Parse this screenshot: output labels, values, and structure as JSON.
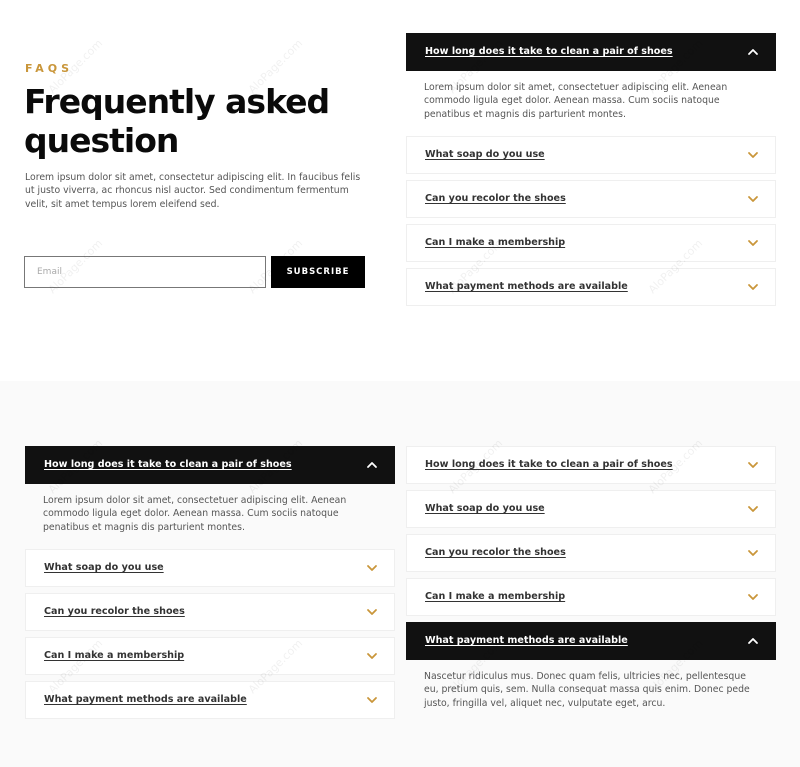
{
  "colors": {
    "accent": "#c9963a",
    "dark": "#111111",
    "body_text": "#555555",
    "section_alt_bg": "#fafafa"
  },
  "hero": {
    "eyebrow": "FAQS",
    "title": "Frequently asked question",
    "description": "Lorem ipsum dolor sit amet, consectetur adipiscing elit. In faucibus felis ut justo viverra, ac rhoncus nisl auctor. Sed condimentum fermentum velit, sit amet tempus lorem eleifend sed.",
    "email_placeholder": "Email",
    "email_value": "",
    "subscribe_label": "SUBSCRIBE"
  },
  "accordion_top_right": {
    "items": [
      {
        "title": "How long does it take to clean a pair of shoes",
        "open": true,
        "icon": "chevron-up-icon",
        "body": "Lorem ipsum dolor sit amet, consectetuer adipiscing elit. Aenean commodo ligula eget dolor. Aenean massa. Cum sociis natoque penatibus et magnis dis parturient montes."
      },
      {
        "title": "What soap do you use",
        "open": false,
        "icon": "chevron-down-icon"
      },
      {
        "title": "Can you recolor the shoes",
        "open": false,
        "icon": "chevron-down-icon"
      },
      {
        "title": "Can I make a membership",
        "open": false,
        "icon": "chevron-down-icon"
      },
      {
        "title": "What payment methods are available",
        "open": false,
        "icon": "chevron-down-icon"
      }
    ]
  },
  "accordion_bottom_left": {
    "items": [
      {
        "title": "How long does it take to clean a pair of shoes",
        "open": true,
        "icon": "chevron-up-icon",
        "body": "Lorem ipsum dolor sit amet, consectetuer adipiscing elit. Aenean commodo ligula eget dolor. Aenean massa. Cum sociis natoque penatibus et magnis dis parturient montes."
      },
      {
        "title": "What soap do you use",
        "open": false,
        "icon": "chevron-down-icon"
      },
      {
        "title": "Can you recolor the shoes",
        "open": false,
        "icon": "chevron-down-icon"
      },
      {
        "title": "Can I make a membership",
        "open": false,
        "icon": "chevron-down-icon"
      },
      {
        "title": "What payment methods are available",
        "open": false,
        "icon": "chevron-down-icon"
      }
    ]
  },
  "accordion_bottom_right": {
    "items": [
      {
        "title": "How long does it take to clean a pair of shoes",
        "open": false,
        "icon": "chevron-down-icon"
      },
      {
        "title": "What soap do you use",
        "open": false,
        "icon": "chevron-down-icon"
      },
      {
        "title": "Can you recolor the shoes",
        "open": false,
        "icon": "chevron-down-icon"
      },
      {
        "title": "Can I make a membership",
        "open": false,
        "icon": "chevron-down-icon"
      },
      {
        "title": "What payment methods are available",
        "open": true,
        "icon": "chevron-up-icon",
        "body": "Nascetur ridiculus mus. Donec quam felis, ultricies nec, pellentesque eu, pretium quis, sem. Nulla consequat massa quis enim. Donec pede justo, fringilla vel, aliquet nec, vulputate eget, arcu."
      }
    ]
  },
  "watermark": "AloPage.com"
}
